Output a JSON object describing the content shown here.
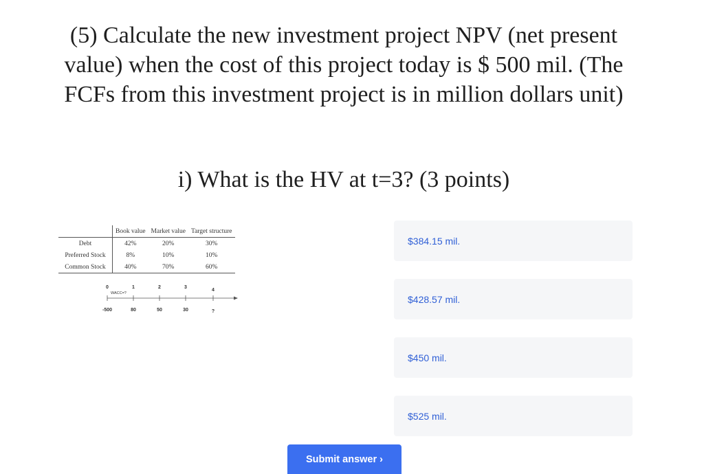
{
  "question": {
    "main": "(5) Calculate the new investment project NPV (net present value) when the cost of this project today is $ 500 mil. (The FCFs from this investment project is in million dollars unit)",
    "sub": "i) What is the HV at t=3? (3 points)"
  },
  "figure": {
    "table": {
      "headers": [
        "",
        "Book value",
        "Market value",
        "Target structure"
      ],
      "rows": [
        {
          "label": "Debt",
          "book": "42%",
          "market": "20%",
          "target": "30%"
        },
        {
          "label": "Preferred Stock",
          "book": "8%",
          "market": "10%",
          "target": "10%"
        },
        {
          "label": "Common Stock",
          "book": "40%",
          "market": "70%",
          "target": "60%"
        }
      ]
    },
    "timeline": {
      "periods": [
        "0",
        "1",
        "2",
        "3",
        "4"
      ],
      "rate_label": "WACC=?",
      "cash_flows": [
        "-500",
        "80",
        "50",
        "30",
        "?"
      ]
    }
  },
  "answers": [
    "$384.15 mil.",
    "$428.57 mil.",
    "$450 mil.",
    "$525 mil."
  ],
  "submit_label": "Submit answer ›"
}
